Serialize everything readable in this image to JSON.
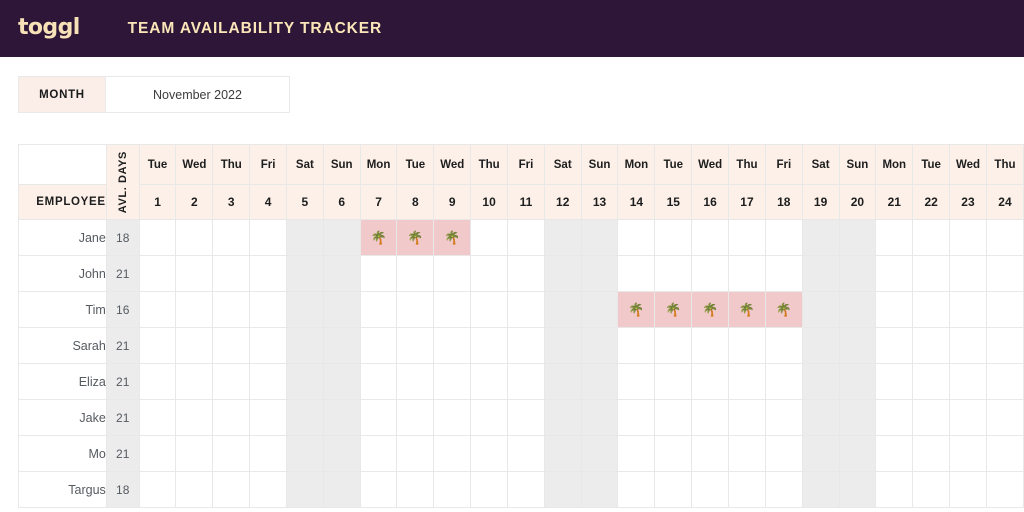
{
  "header": {
    "logo_text": "toggl",
    "title": "TEAM AVAILABILITY TRACKER",
    "bg_color": "#2d1637",
    "logo_color": "#f7e2b8",
    "title_color": "#fbe6b9"
  },
  "month_selector": {
    "label": "MONTH",
    "value": "November 2022",
    "label_bg": "#fbeee8"
  },
  "table": {
    "employee_header": "EMPLOYEE",
    "avl_days_header": "AVL. DAYS",
    "header_bg": "#fcf0e9",
    "weekend_bg": "#ececec",
    "vacation_bg": "#f2c9ca",
    "vacation_icon": "🌴",
    "days": [
      {
        "dow": "Tue",
        "num": "1",
        "weekend": false
      },
      {
        "dow": "Wed",
        "num": "2",
        "weekend": false
      },
      {
        "dow": "Thu",
        "num": "3",
        "weekend": false
      },
      {
        "dow": "Fri",
        "num": "4",
        "weekend": false
      },
      {
        "dow": "Sat",
        "num": "5",
        "weekend": true
      },
      {
        "dow": "Sun",
        "num": "6",
        "weekend": true
      },
      {
        "dow": "Mon",
        "num": "7",
        "weekend": false
      },
      {
        "dow": "Tue",
        "num": "8",
        "weekend": false
      },
      {
        "dow": "Wed",
        "num": "9",
        "weekend": false
      },
      {
        "dow": "Thu",
        "num": "10",
        "weekend": false
      },
      {
        "dow": "Fri",
        "num": "11",
        "weekend": false
      },
      {
        "dow": "Sat",
        "num": "12",
        "weekend": true
      },
      {
        "dow": "Sun",
        "num": "13",
        "weekend": true
      },
      {
        "dow": "Mon",
        "num": "14",
        "weekend": false
      },
      {
        "dow": "Tue",
        "num": "15",
        "weekend": false
      },
      {
        "dow": "Wed",
        "num": "16",
        "weekend": false
      },
      {
        "dow": "Thu",
        "num": "17",
        "weekend": false
      },
      {
        "dow": "Fri",
        "num": "18",
        "weekend": false
      },
      {
        "dow": "Sat",
        "num": "19",
        "weekend": true
      },
      {
        "dow": "Sun",
        "num": "20",
        "weekend": true
      },
      {
        "dow": "Mon",
        "num": "21",
        "weekend": false
      },
      {
        "dow": "Tue",
        "num": "22",
        "weekend": false
      },
      {
        "dow": "Wed",
        "num": "23",
        "weekend": false
      },
      {
        "dow": "Thu",
        "num": "24",
        "weekend": false
      }
    ],
    "rows": [
      {
        "employee": "Jane",
        "avl_days": "18",
        "vacation_days": [
          7,
          8,
          9
        ]
      },
      {
        "employee": "John",
        "avl_days": "21",
        "vacation_days": []
      },
      {
        "employee": "Tim",
        "avl_days": "16",
        "vacation_days": [
          14,
          15,
          16,
          17,
          18
        ]
      },
      {
        "employee": "Sarah",
        "avl_days": "21",
        "vacation_days": []
      },
      {
        "employee": "Eliza",
        "avl_days": "21",
        "vacation_days": []
      },
      {
        "employee": "Jake",
        "avl_days": "21",
        "vacation_days": []
      },
      {
        "employee": "Mo",
        "avl_days": "21",
        "vacation_days": []
      },
      {
        "employee": "Targus",
        "avl_days": "18",
        "vacation_days": []
      }
    ]
  }
}
